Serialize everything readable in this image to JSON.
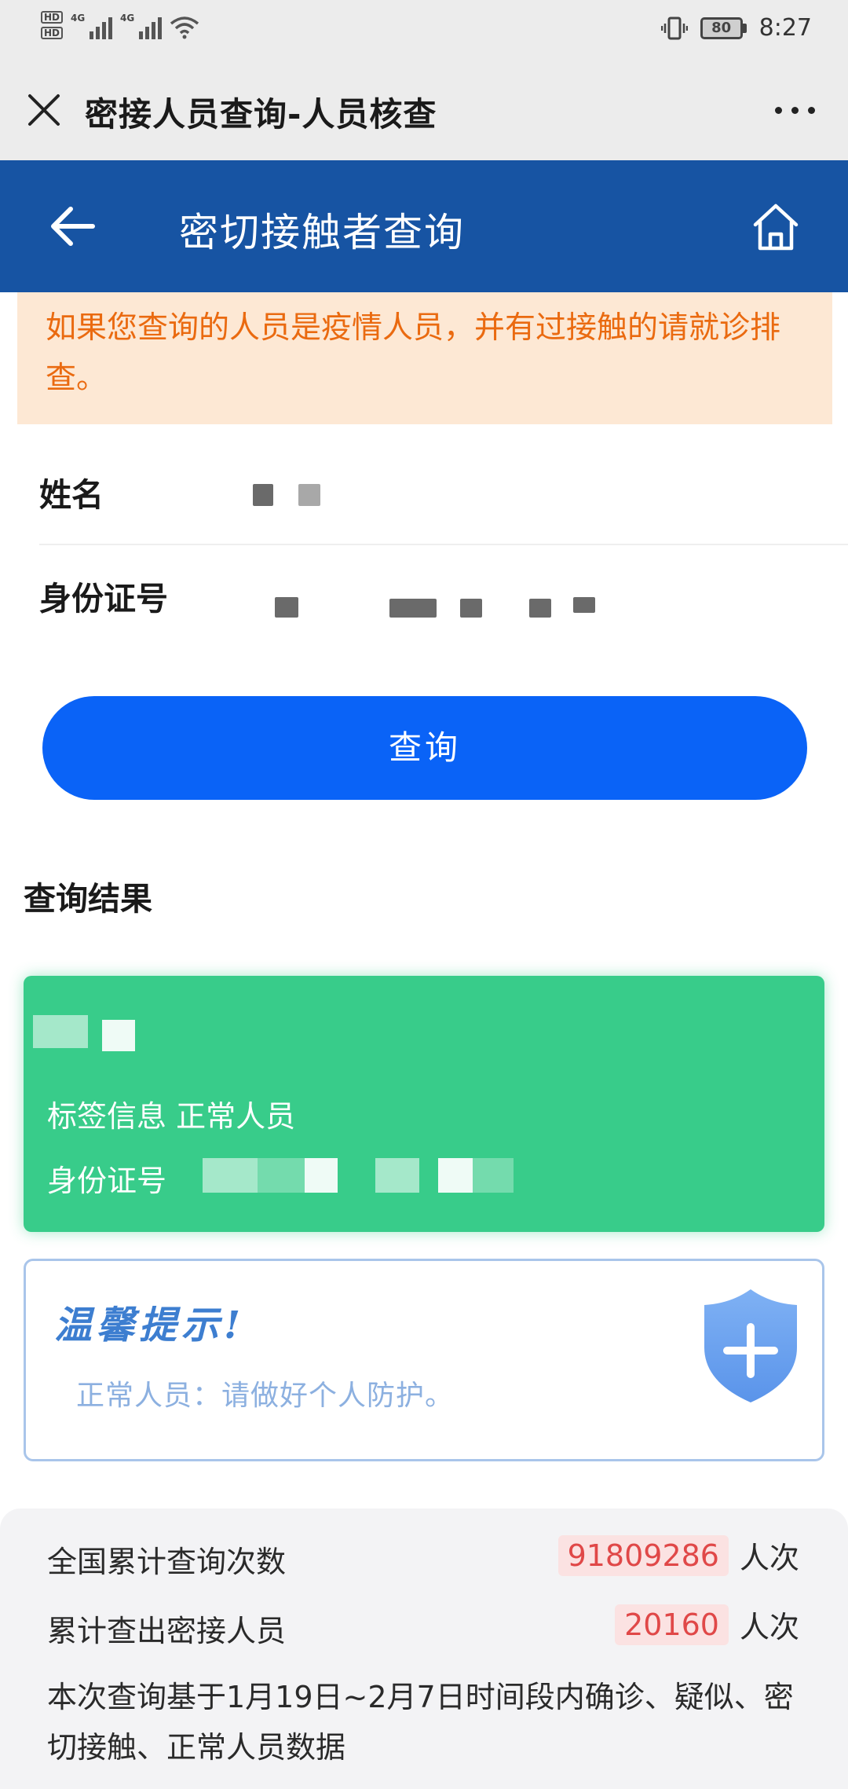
{
  "status_bar": {
    "hd_label": "HD",
    "network_1": "4G",
    "network_2": "4G",
    "battery": "80",
    "time": "8:27"
  },
  "title_bar": {
    "title": "密接人员查询-人员核查",
    "close_icon": "close-icon",
    "more_icon": "more-icon"
  },
  "header": {
    "title": "密切接触者查询",
    "back_icon": "back-arrow-icon",
    "home_icon": "home-icon",
    "color": "#1754a3"
  },
  "warning": {
    "text": "如果您查询的人员是疫情人员，并有过接触的请就诊排查。",
    "color": "#ea6a10"
  },
  "form": {
    "name_label": "姓名",
    "id_label": "身份证号",
    "query_button": "查询",
    "button_color": "#0a63f7"
  },
  "result": {
    "section_title": "查询结果",
    "tag_line": "标签信息 正常人员",
    "id_label": "身份证号",
    "card_color": "#38cc8a"
  },
  "tips": {
    "title": "温馨提示!",
    "text": "正常人员：请做好个人防护。",
    "icon": "shield-plus-icon"
  },
  "stats": {
    "total_query_label": "全国累计查询次数",
    "total_query_value": "91809286",
    "total_query_unit": "人次",
    "contacts_label": "累计查出密接人员",
    "contacts_value": "20160",
    "contacts_unit": "人次",
    "note": "本次查询基于1月19日~2月7日时间段内确诊、疑似、密切接触、正常人员数据"
  }
}
